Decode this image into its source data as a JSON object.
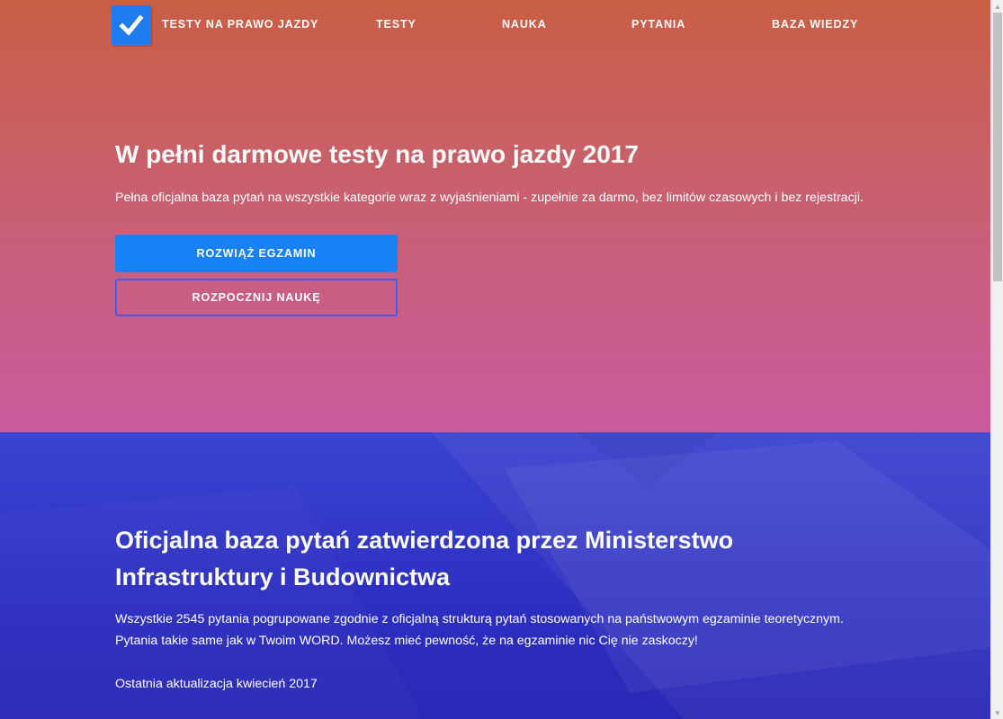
{
  "nav": {
    "brand": "TESTY NA PRAWO JAZDY",
    "links": [
      "TESTY",
      "NAUKA",
      "PYTANIA",
      "BAZA WIEDZY"
    ],
    "logo_icon": "checkmark-icon"
  },
  "hero": {
    "title": "W pełni darmowe testy na prawo jazdy 2017",
    "subtitle": "Pełna oficjalna baza pytań na wszystkie kategorie wraz z wyjaśnieniami - zupełnie za darmo, bez limitów czasowych i bez rejestracji.",
    "primary_button": "ROZWIĄŻ EGZAMIN",
    "secondary_button": "ROZPOCZNIJ NAUKĘ"
  },
  "section2": {
    "title": "Oficjalna baza pytań zatwierdzona przez Ministerstwo Infrastruktury i Budownictwa",
    "text_line1": "Wszystkie 2545 pytania pogrupowane zgodnie z oficjalną strukturą pytań stosowanych na państwowym egzaminie teoretycznym.",
    "text_line2": "Pytania takie same jak w Twoim WORD. Możesz mieć pewność, że na egzaminie nic Cię nie zaskoczy!",
    "update": "Ostatnia aktualizacja kwiecień 2017"
  },
  "colors": {
    "hero_top": "#c95e45",
    "hero_bottom": "#c95c9e",
    "primary_button": "#1a82f7",
    "section2_bg": "#2d2fc0",
    "logo_bg": "#1e7bf0"
  }
}
